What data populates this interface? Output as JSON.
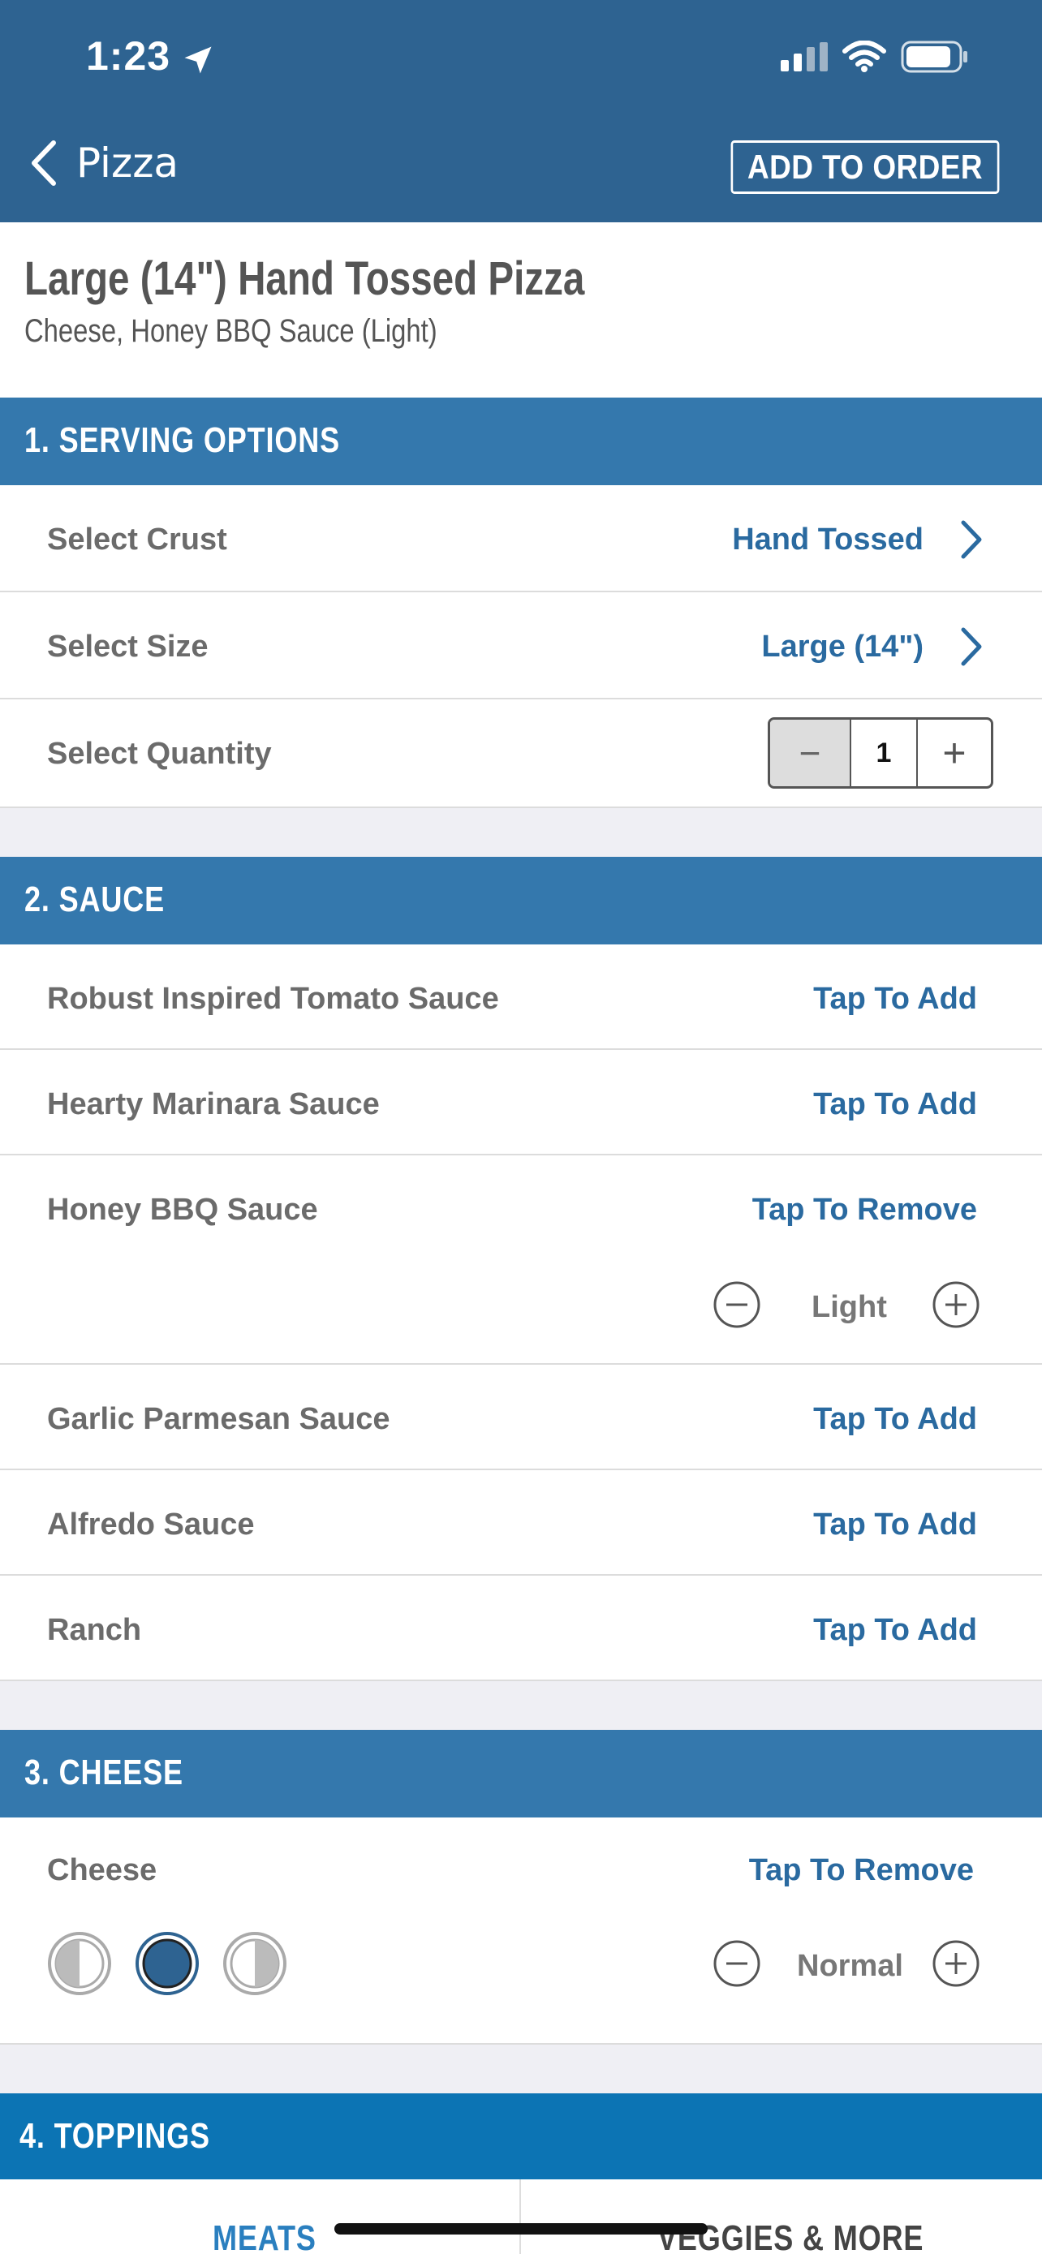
{
  "status_bar": {
    "time": "1:23"
  },
  "nav": {
    "back_label": "Pizza",
    "add_to_order": "ADD TO ORDER"
  },
  "product": {
    "title": "Large (14\") Hand Tossed Pizza",
    "subtitle": "Cheese, Honey BBQ Sauce (Light)"
  },
  "sections": {
    "serving": "1. SERVING OPTIONS",
    "sauce": "2. SAUCE",
    "cheese": "3. CHEESE",
    "toppings": "4. TOPPINGS"
  },
  "serving_options": {
    "crust_label": "Select Crust",
    "crust_value": "Hand Tossed",
    "size_label": "Select Size",
    "size_value": "Large (14\")",
    "quantity_label": "Select Quantity",
    "quantity_value": "1",
    "minus": "−",
    "plus": "+"
  },
  "sauces": [
    {
      "name": "Robust Inspired Tomato Sauce",
      "action": "Tap To Add"
    },
    {
      "name": "Hearty Marinara Sauce",
      "action": "Tap To Add"
    },
    {
      "name": "Honey BBQ Sauce",
      "action": "Tap To Remove",
      "amount": "Light"
    },
    {
      "name": "Garlic Parmesan Sauce",
      "action": "Tap To Add"
    },
    {
      "name": "Alfredo Sauce",
      "action": "Tap To Add"
    },
    {
      "name": "Ranch",
      "action": "Tap To Add"
    }
  ],
  "cheese": {
    "name": "Cheese",
    "action": "Tap To Remove",
    "amount": "Normal"
  },
  "topping_tabs": {
    "meats": "MEATS",
    "veggies": "VEGGIES & MORE"
  },
  "colors": {
    "header": "#2e6391",
    "section": "#3478ad",
    "toppings_section": "#0c74b4",
    "accent": "#2a6aa0"
  }
}
